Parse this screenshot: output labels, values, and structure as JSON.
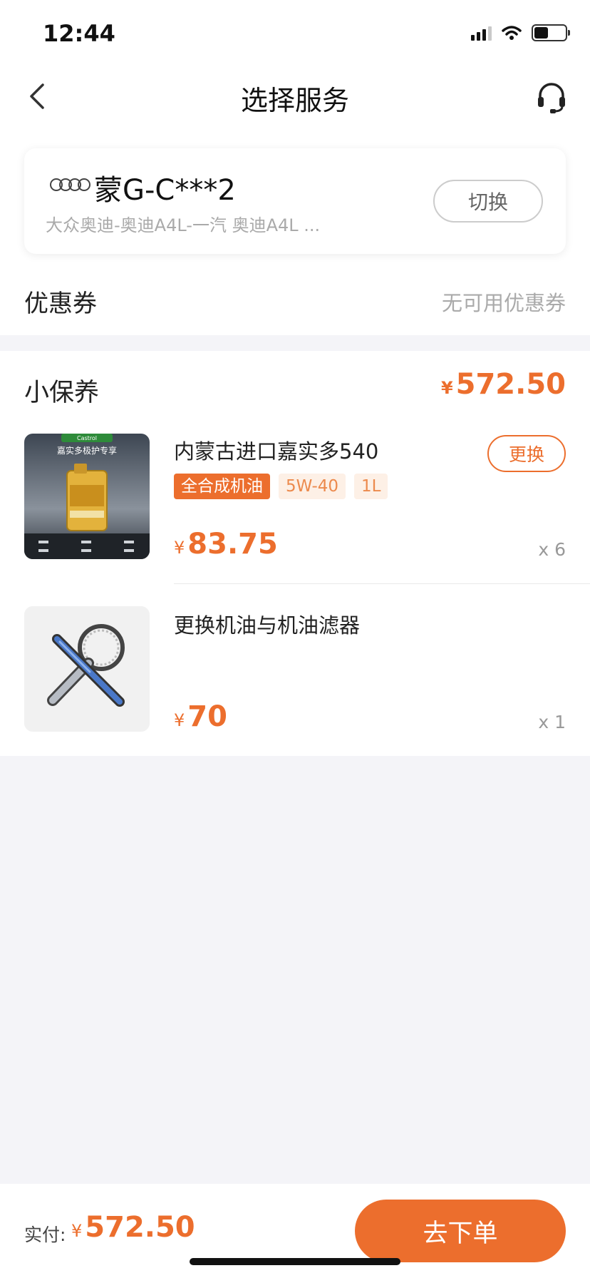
{
  "status_bar": {
    "time": "12:44"
  },
  "nav": {
    "title": "选择服务"
  },
  "car": {
    "plate": "蒙G-C***2",
    "model": "大众奥迪-奥迪A4L-一汽 奥迪A4L ...",
    "switch_label": "切换"
  },
  "coupon": {
    "label": "优惠券",
    "value": "无可用优惠券"
  },
  "service": {
    "title": "小保养",
    "currency": "¥",
    "total": "572.50",
    "items": [
      {
        "name": "内蒙古进口嘉实多540",
        "tags": [
          "全合成机油",
          "5W-40",
          "1L"
        ],
        "replace_label": "更换",
        "price": "83.75",
        "qty": "x 6",
        "image_text": {
          "brand": "Castrol",
          "headline": "嘉实多极护专享"
        }
      },
      {
        "name": "更换机油与机油滤器",
        "price": "70",
        "qty": "x 1"
      }
    ]
  },
  "footer": {
    "pay_label": "实付:",
    "currency": "¥",
    "pay_amount": "572.50",
    "order_label": "去下单"
  },
  "colors": {
    "accent": "#ec6e2d",
    "tag_soft_bg": "#fdf0e6",
    "page_bg": "#f4f4f8"
  }
}
